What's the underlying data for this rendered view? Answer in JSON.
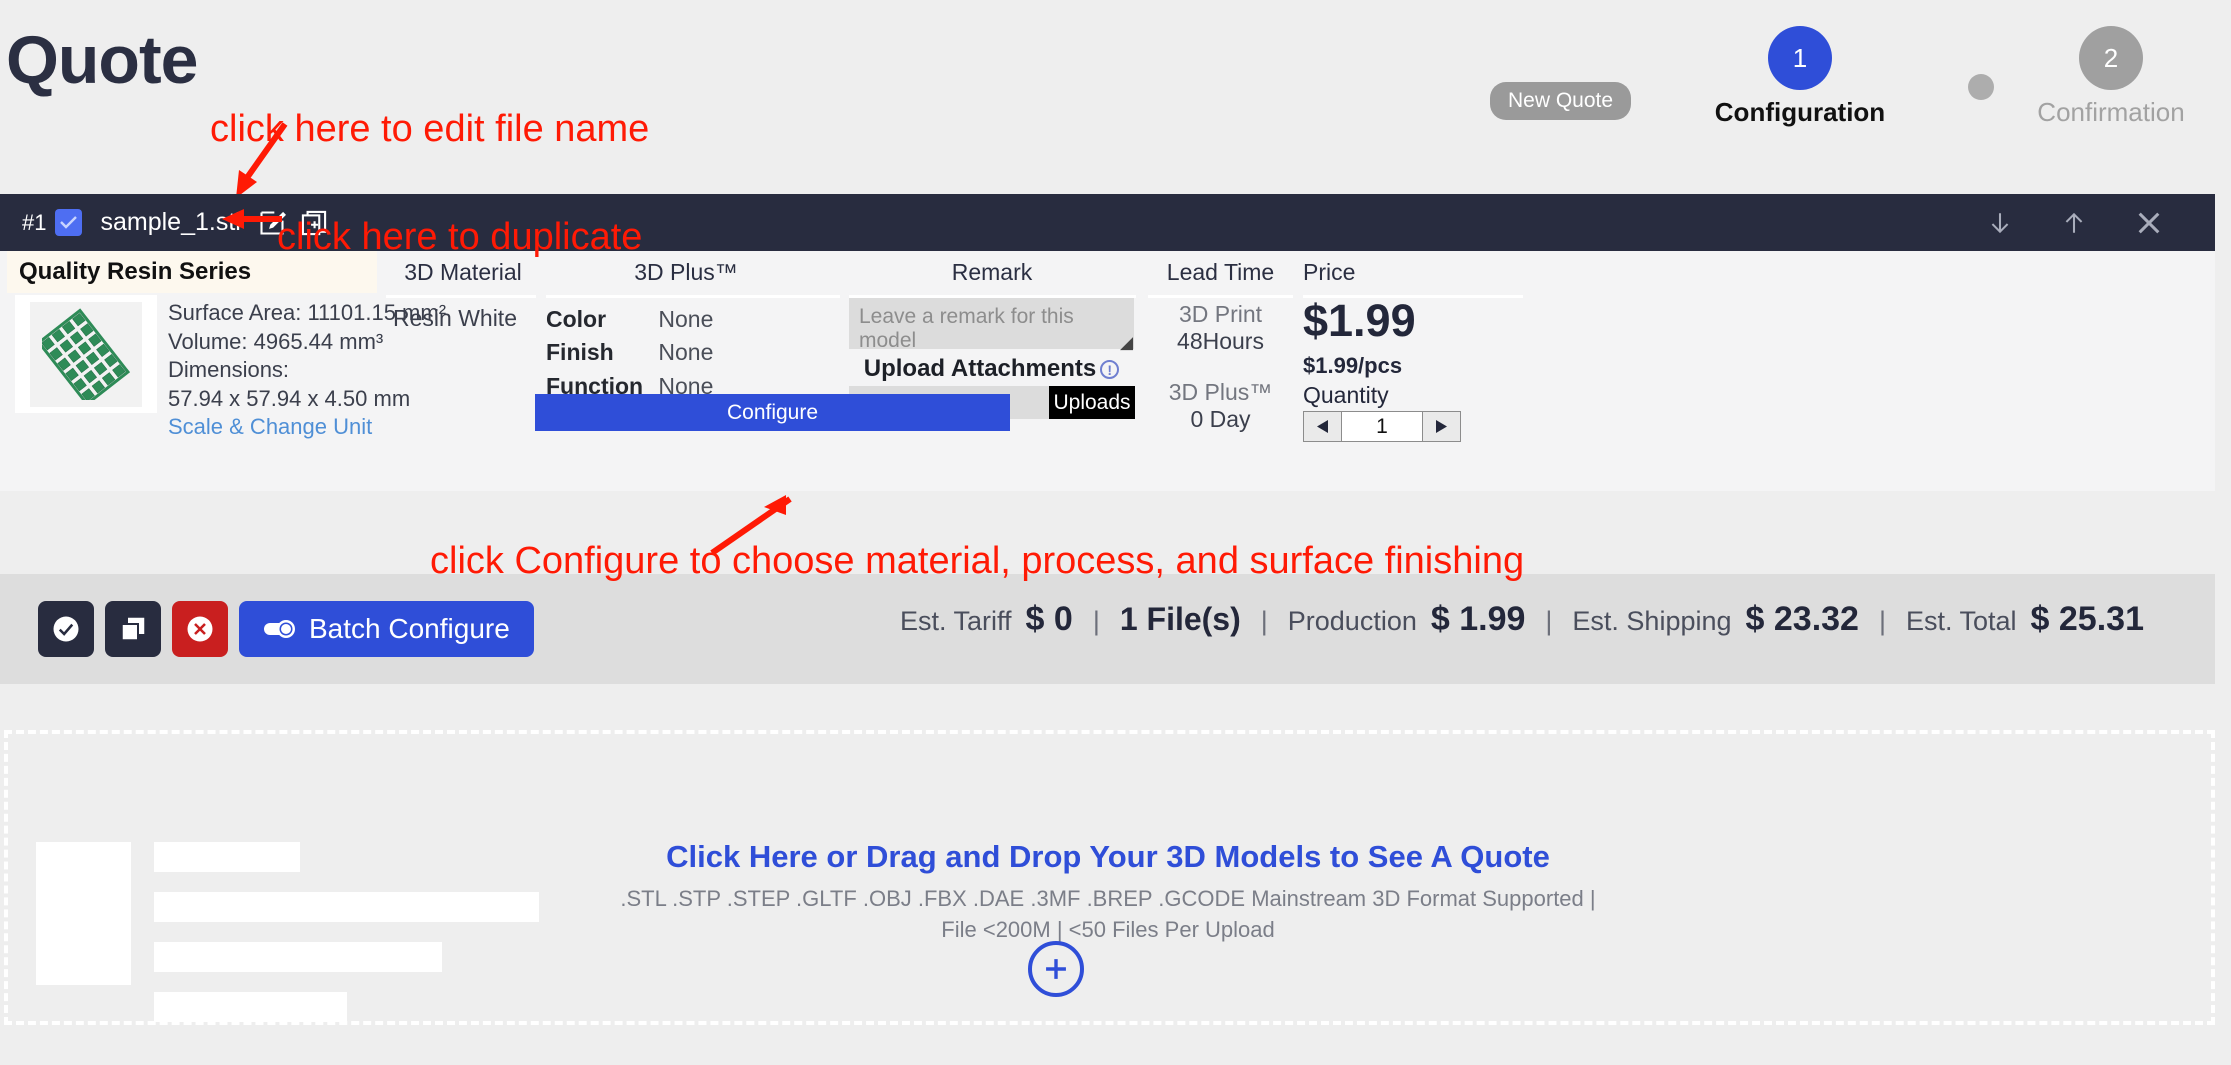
{
  "header": {
    "title": "Quote",
    "new_quote_pill": "New Quote"
  },
  "stepper": {
    "steps": [
      {
        "number": "1",
        "label": "Configuration",
        "state": "active"
      },
      {
        "number": "2",
        "label": "Confirmation",
        "state": "inactive"
      }
    ],
    "active_color": "#2f4ed8",
    "inactive_color": "#a0a0a0"
  },
  "annotations": [
    {
      "id": "edit-file-name",
      "text": "click here to edit file name",
      "color": "#ff1a05"
    },
    {
      "id": "duplicate",
      "text": "click here to duplicate",
      "color": "#ff1a05"
    },
    {
      "id": "configure",
      "text": "click Configure to choose material, process, and surface finishing",
      "color": "#ff1a05"
    }
  ],
  "file_card": {
    "index": "#1",
    "file_name": "sample_1.stl",
    "checked": true,
    "edit_icon": "edit-pencil-icon",
    "duplicate_icon": "duplicate-icon",
    "move_down_icon": "arrow-down-icon",
    "move_up_icon": "arrow-up-icon",
    "close_icon": "close-icon",
    "quality_banner": "Quality Resin Series",
    "columns": [
      {
        "key": "material",
        "label": "3D Material"
      },
      {
        "key": "plus",
        "label": "3D Plus™"
      },
      {
        "key": "remark",
        "label": "Remark"
      },
      {
        "key": "lead_time",
        "label": "Lead Time"
      },
      {
        "key": "price",
        "label": "Price"
      }
    ],
    "model": {
      "surface_area_label": "Surface Area:",
      "surface_area_value": "11101.15 mm²",
      "volume_label": "Volume:",
      "volume_value": "4965.44 mm³",
      "dimensions_label": "Dimensions:",
      "dimensions_value": "57.94 x 57.94 x 4.50 mm",
      "scale_link": "Scale & Change Unit",
      "thumbnail_color": "#2e8b57"
    },
    "material": {
      "value": "Resin White"
    },
    "plus": {
      "rows": [
        {
          "key": "Color",
          "value": "None"
        },
        {
          "key": "Finish",
          "value": "None"
        },
        {
          "key": "Function",
          "value": "None"
        }
      ]
    },
    "remark": {
      "placeholder": "Leave a remark for this model",
      "value": "",
      "upload_attachments_label": "Upload Attachments",
      "upload_input_value": "",
      "uploads_button": "Uploads"
    },
    "lead_time": {
      "print_label": "3D Print",
      "print_value": "48Hours",
      "plus_label": "3D Plus™",
      "plus_value": "0 Day"
    },
    "price": {
      "total": "$1.99",
      "unit": "$1.99/pcs",
      "quantity_label": "Quantity",
      "quantity_value": "1",
      "dec_icon": "triangle-left-icon",
      "inc_icon": "triangle-right-icon"
    },
    "configure_button": "Configure"
  },
  "batch_bar": {
    "select_all_icon": "check-circle-icon",
    "duplicate_icon": "copy-icon",
    "delete_icon": "x-circle-icon",
    "batch_configure_label": "Batch Configure",
    "batch_configure_icon": "toggle-icon",
    "totals": [
      {
        "label": "Est. Tariff",
        "value": "$ 0"
      },
      {
        "label": "",
        "value": "1 File(s)"
      },
      {
        "label": "Production",
        "value": "$ 1.99"
      },
      {
        "label": "Est. Shipping",
        "value": "$ 23.32"
      },
      {
        "label": "Est. Total",
        "value": "$ 25.31"
      }
    ],
    "separator": "|"
  },
  "dropzone": {
    "title": "Click Here or Drag and Drop Your 3D Models to See A Quote",
    "subtitle": ".STL .STP .STEP .GLTF .OBJ .FBX .DAE .3MF .BREP .GCODE Mainstream 3D Format Supported | File <200M | <50 Files Per Upload",
    "add_icon": "plus-circle-icon",
    "accent_color": "#2f4ed8"
  }
}
